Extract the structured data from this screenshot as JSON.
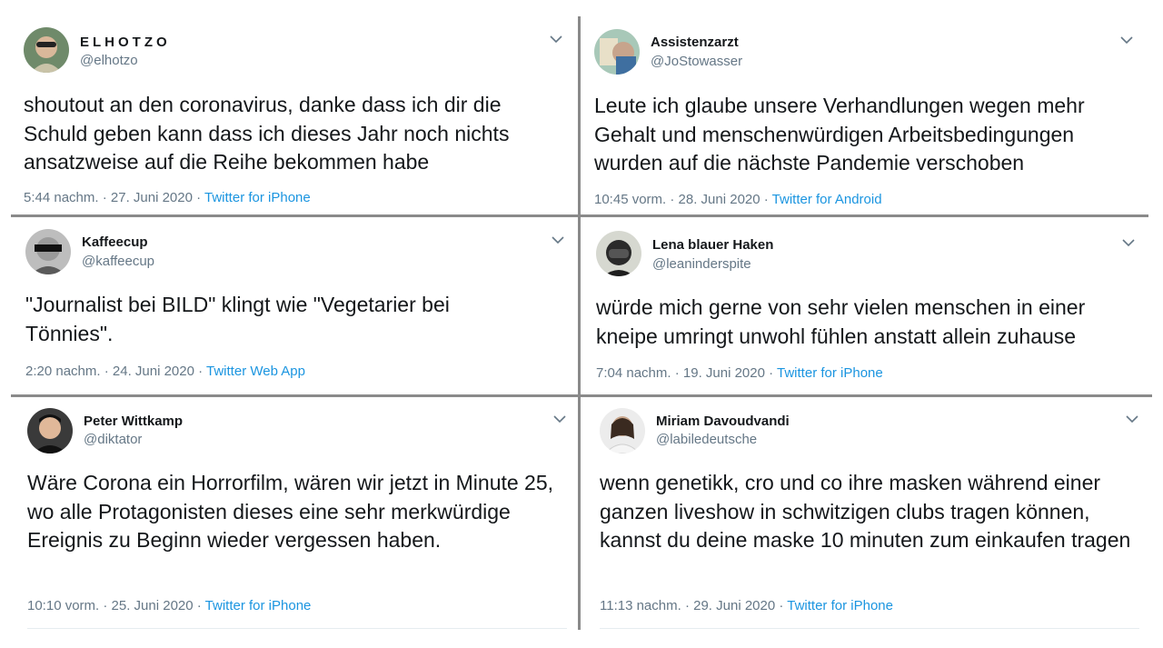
{
  "tweets": [
    {
      "name": "ELHOTZO",
      "handle": "@elhotzo",
      "text": "shoutout an den coronavirus, danke dass ich dir die Schuld geben kann dass ich dieses Jahr noch nichts ansatzweise auf die Reihe bekommen habe",
      "time": "5:44 nachm. · 27. Juni 2020 · ",
      "app": "Twitter for iPhone"
    },
    {
      "name": "Assistenzarzt",
      "handle": "@JoStowasser",
      "text": "Leute ich glaube unsere Verhandlungen wegen mehr Gehalt und menschenwürdigen Arbeitsbedingungen wurden auf die nächste Pandemie verschoben",
      "time": "10:45 vorm. · 28. Juni 2020 · ",
      "app": "Twitter for Android"
    },
    {
      "name": "Kaffeecup",
      "handle": "@kaffeecup",
      "text": "\"Journalist bei BILD\" klingt wie \"Vegetarier bei Tönnies\".",
      "time": "2:20 nachm. · 24. Juni 2020 · ",
      "app": "Twitter Web App"
    },
    {
      "name": "Lena blauer Haken",
      "handle": "@leaninderspite",
      "text": "würde mich gerne von sehr vielen menschen in einer kneipe umringt unwohl fühlen anstatt allein zuhause",
      "time": "7:04 nachm. · 19. Juni 2020 · ",
      "app": "Twitter for iPhone"
    },
    {
      "name": "Peter Wittkamp",
      "handle": "@diktator",
      "text": "Wäre Corona ein Horrorfilm, wären wir jetzt in Minute 25, wo alle Protagonisten dieses eine sehr merkwürdige Ereignis zu Beginn wieder vergessen haben.",
      "time": "10:10 vorm. · 25. Juni 2020 · ",
      "app": "Twitter for iPhone"
    },
    {
      "name": "Miriam Davoudvandi",
      "handle": "@labiledeutsche",
      "text": "wenn genetikk, cro und co ihre masken während einer ganzen liveshow in schwitzigen clubs tragen können, kannst du deine maske 10 minuten zum einkaufen tragen",
      "time": "11:13 nachm. · 29. Juni 2020 · ",
      "app": "Twitter for iPhone"
    }
  ],
  "icons": {
    "menu": "chevron-down-icon",
    "avatar": "avatar-icon"
  },
  "colors": {
    "link": "#1b95e0",
    "secondary": "#657786",
    "divider": "#8a8a8a"
  }
}
